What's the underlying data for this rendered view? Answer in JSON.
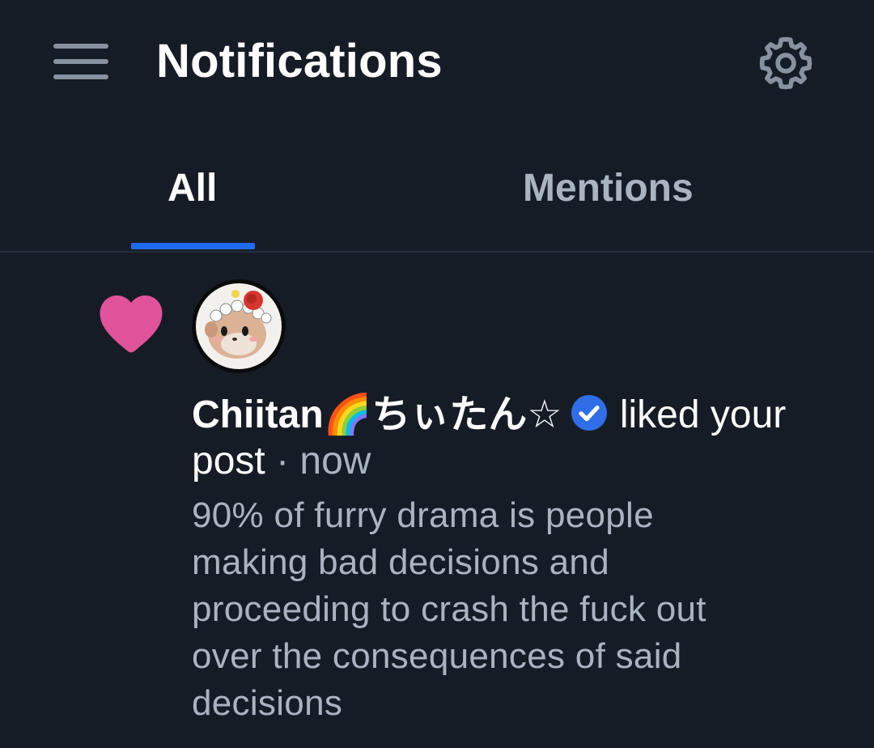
{
  "header": {
    "title": "Notifications",
    "menu_icon": "hamburger-menu-icon",
    "settings_icon": "gear-icon"
  },
  "tabs": [
    {
      "label": "All",
      "selected": true
    },
    {
      "label": "Mentions",
      "selected": false
    }
  ],
  "notification": {
    "type_icon": "heart-icon",
    "author_name": "Chiitan🌈ちぃたん☆",
    "verified_icon": "verified-check-icon",
    "action": "liked your post",
    "separator": "·",
    "time": "now",
    "post_text": "90% of furry drama is people\nmaking bad decisions and\nproceeding to crash the fuck out\nover the consequences of said\ndecisions"
  },
  "colors": {
    "background": "#161c26",
    "tab_indicator": "#1f6bf0",
    "heart": "#e0539b",
    "verified": "#2f6ee6",
    "muted_text": "#aab3c0"
  }
}
